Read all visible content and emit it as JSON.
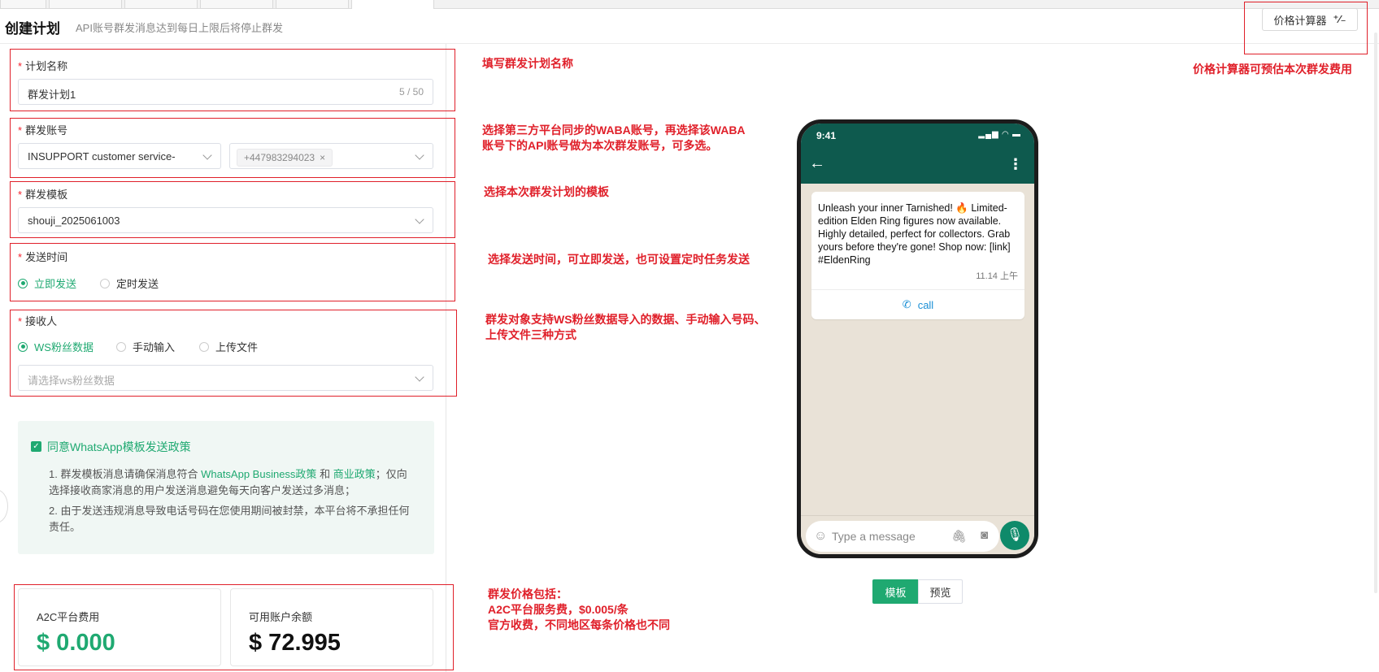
{
  "header": {
    "title": "创建计划",
    "subtitle": "API账号群发消息达到每日上限后将停止群发",
    "calculator_label": "价格计算器",
    "calculator_icon": "calculator-icon"
  },
  "form": {
    "plan_name": {
      "label": "计划名称",
      "value": "群发计划1",
      "counter": "5 / 50"
    },
    "account": {
      "label": "群发账号",
      "waba_value": "INSUPPORT customer service-",
      "tag": "+447983294023",
      "tag_close": "×"
    },
    "template": {
      "label": "群发模板",
      "value": "shouji_2025061003"
    },
    "send_time": {
      "label": "发送时间",
      "options": [
        "立即发送",
        "定时发送"
      ],
      "selected": "立即发送"
    },
    "recipients": {
      "label": "接收人",
      "options": [
        "WS粉丝数据",
        "手动输入",
        "上传文件"
      ],
      "selected": "WS粉丝数据",
      "placeholder": "请选择ws粉丝数据"
    }
  },
  "policy": {
    "checkbox_label": "同意WhatsApp模板发送政策",
    "line1_a": "1. 群发模板消息请确保消息符合",
    "link1": "WhatsApp Business政策",
    "and": "和",
    "link2": "商业政策",
    "line1_b": "；仅向",
    "line1_c": "选择接收商家消息的用户发送消息避免每天向客户发送过多消息；",
    "line2_a": "2. 由于发送违规消息导致电话号码在您使用期间被封禁，本平台将不承担任何",
    "line2_b": "责任。"
  },
  "cards": {
    "fee": {
      "title": "A2C平台费用",
      "value": "$ 0.000",
      "color": "#1fa971"
    },
    "balance": {
      "title": "可用账户余额",
      "value": "$ 72.995",
      "color": "#111111"
    }
  },
  "annotations": {
    "a1": "填写群发计划名称",
    "a2_l1": "选择第三方平台同步的WABA账号，再选择该WABA",
    "a2_l2": "账号下的API账号做为本次群发账号，可多选。",
    "a3": "选择本次群发计划的模板",
    "a4": "选择发送时间，可立即发送，也可设置定时任务发送",
    "a5_l1": "群发对象支持WS粉丝数据导入的数据、手动输入号码、",
    "a5_l2": "上传文件三种方式",
    "a6_l1": "群发价格包括：",
    "a6_l2": "A2C平台服务费，$0.005/条",
    "a6_l3": "官方收费，不同地区每条价格也不同",
    "a7": "价格计算器可预估本次群发费用"
  },
  "phone": {
    "time": "9:41",
    "message": "Unleash your inner Tarnished! 🔥 Limited-edition Elden Ring figures now available. Highly detailed, perfect for collectors. Grab yours before they're gone! Shop now: [link] #EldenRing",
    "timestamp": "11.14 上午",
    "button": "call",
    "compose_placeholder": "Type a message"
  },
  "preview_tabs": {
    "active": "模板",
    "inactive": "预览"
  },
  "colors": {
    "accent": "#1fa971",
    "annotation": "#e0202a",
    "whatsapp_header": "#0e5a4e"
  }
}
